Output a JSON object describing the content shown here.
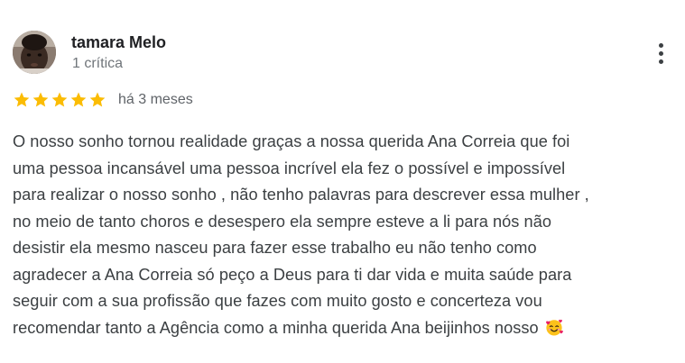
{
  "review": {
    "author_name": "tamara Melo",
    "author_meta": "1 crítica",
    "rating": 5,
    "rating_max": 5,
    "time_ago": "há 3 meses",
    "star_color": "#fbbc04",
    "text_lines": [
      "O nosso sonho tornou realidade graças a nossa querida Ana Correia que foi",
      "uma pessoa incansável uma pessoa incrível ela fez o possível e impossível",
      "para realizar o nosso sonho , não tenho palavras para descrever essa mulher ,",
      "no meio de tanto choros e desespero ela sempre esteve a li para nós não",
      "desistir ela mesmo nasceu para fazer esse trabalho eu não tenho como",
      "agradecer a Ana Correia só peço a Deus para ti dar vida e muita saúde para",
      "seguir com a sua profissão que fazes com muito gosto e concerteza vou",
      "recomendar tanto a Agência como a minha querida Ana beijinhos nosso"
    ],
    "end_emoji": "smiling-face-with-hearts-icon",
    "menu_icon": "more-vertical-icon"
  }
}
